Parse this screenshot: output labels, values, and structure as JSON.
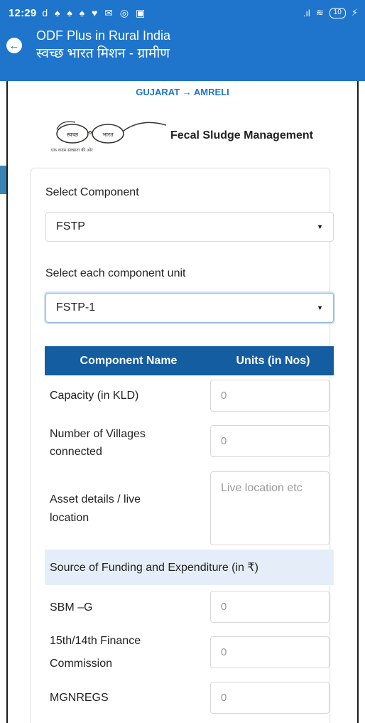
{
  "status": {
    "time": "12:29",
    "icons": "d ♠ ♠ ♠ ♥ ✉ ◎ ▣",
    "signal": ".ıl",
    "wifi": "≋",
    "battery": "10"
  },
  "header": {
    "title_en": "ODF Plus in Rural India",
    "title_hi": "स्वच्छ भारत मिशन - ग्रामीण"
  },
  "breadcrumb": "GUJARAT → AMRELI",
  "logo": {
    "caption": "Fecal Sludge Management",
    "glasses_left": "स्वच्छ",
    "glasses_right": "भारत",
    "tagline": "एक कदम स्वच्छता की ओर"
  },
  "form": {
    "component_label": "Select Component",
    "component_value": "FSTP",
    "unit_label": "Select each component unit",
    "unit_value": "FSTP-1"
  },
  "table": {
    "col_name": "Component Name",
    "col_units": "Units (in Nos)",
    "rows": [
      {
        "label": "Capacity (in KLD)",
        "placeholder": "0"
      },
      {
        "label_1": "Number of Villages",
        "label_2": "connected",
        "placeholder": "0"
      },
      {
        "label_1": "Asset details / live",
        "label_2": "location",
        "placeholder": "Live location etc"
      }
    ],
    "funding_header": "Source of Funding and Expenditure (in ₹)",
    "funding": [
      {
        "label": "SBM –G",
        "placeholder": "0"
      },
      {
        "label_1": "15th/14th Finance",
        "label_2": "Commission",
        "placeholder": "0"
      },
      {
        "label": "MGNREGS",
        "placeholder": "0"
      }
    ]
  }
}
